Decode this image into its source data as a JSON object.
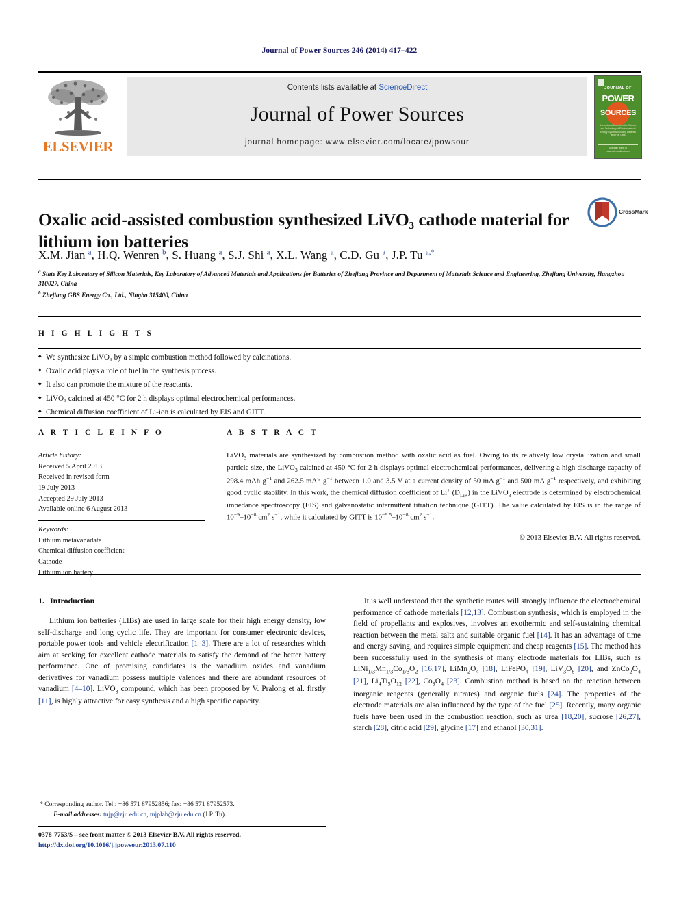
{
  "running_head": "Journal of Power Sources 246 (2014) 417–422",
  "masthead": {
    "publisher_name": "ELSEVIER",
    "contents_prefix": "Contents lists available at ",
    "sciencedirect": "ScienceDirect",
    "journal_title": "Journal of Power Sources",
    "homepage": "journal homepage: www.elsevier.com/locate/jpowsour",
    "cover": {
      "line1": "JOURNAL OF",
      "line2": "POWER",
      "line3": "SOURCES",
      "subtitle": "International Journal on the Science and Technology of Electrochemical Energy Systems including Batteries and Fuel Cells",
      "footer": "Available online at www.sciencedirect.com"
    }
  },
  "article": {
    "title": "Oxalic acid-assisted combustion synthesized LiVO₃ cathode material for lithium ion batteries",
    "crossmark_label": "CrossMark",
    "authors_html": "X.M. Jian <sup>a</sup>, H.Q. Wenren <sup>b</sup>, S. Huang <sup>a</sup>, S.J. Shi <sup>a</sup>, X.L. Wang <sup>a</sup>, C.D. Gu <sup>a</sup>, J.P. Tu <sup>a,*</sup>",
    "affiliation_a": "State Key Laboratory of Silicon Materials, Key Laboratory of Advanced Materials and Applications for Batteries of Zhejiang Province and Department of Materials Science and Engineering, Zhejiang University, Hangzhou 310027, China",
    "affiliation_b": "Zhejiang GBS Energy Co., Ltd., Ningbo 315400, China"
  },
  "highlights": {
    "heading": "H I G H L I G H T S",
    "items": [
      "We synthesize LiVO₃ by a simple combustion method followed by calcinations.",
      "Oxalic acid plays a role of fuel in the synthesis process.",
      "It also can promote the mixture of the reactants.",
      "LiVO₃ calcined at 450 °C for 2 h displays optimal electrochemical performances.",
      "Chemical diffusion coefficient of Li-ion is calculated by EIS and GITT."
    ]
  },
  "article_info": {
    "heading": "A R T I C L E   I N F O",
    "history_label": "Article history:",
    "history": [
      "Received 5 April 2013",
      "Received in revised form",
      "19 July 2013",
      "Accepted 29 July 2013",
      "Available online 6 August 2013"
    ],
    "keywords_label": "Keywords:",
    "keywords": [
      "Lithium metavanadate",
      "Chemical diffusion coefficient",
      "Cathode",
      "Lithium ion battery"
    ]
  },
  "abstract": {
    "heading": "A B S T R A C T",
    "text_html": "LiVO<sub>3</sub> materials are synthesized by combustion method with oxalic acid as fuel. Owing to its relatively low crystallization and small particle size, the LiVO<sub>3</sub> calcined at 450 °C for 2 h displays optimal electrochemical performances, delivering a high discharge capacity of 298.4 mAh g<sup>−1</sup> and 262.5 mAh g<sup>−1</sup> between 1.0 and 3.5 V at a current density of 50 mA g<sup>−1</sup> and 500 mA g<sup>−1</sup> respectively, and exhibiting good cyclic stability. In this work, the chemical diffusion coefficient of Li<sup>+</sup> (D<sub>Li+</sub>) in the LiVO<sub>3</sub> electrode is determined by electrochemical impedance spectroscopy (EIS) and galvanostatic intermittent titration technique (GITT). The value calculated by EIS is in the range of 10<sup>−9</sup>–10<sup>−8</sup> cm<sup>2</sup> s<sup>−1</sup>, while it calculated by GITT is 10<sup>−9.5</sup>–10<sup>−8</sup> cm<sup>2</sup> s<sup>−1</sup>.",
    "copyright": "© 2013 Elsevier B.V. All rights reserved."
  },
  "introduction": {
    "number": "1.",
    "heading": "Introduction",
    "left_paragraph_html": "Lithium ion batteries (LIBs) are used in large scale for their high energy density, low self-discharge and long cyclic life. They are important for consumer electronic devices, portable power tools and vehicle electrification <span class=\"cite\">[1–3]</span>. There are a lot of researches which aim at seeking for excellent cathode materials to satisfy the demand of the better battery performance. One of promising candidates is the vanadium oxides and vanadium derivatives for vanadium possess multiple valences and there are abundant resources of vanadium <span class=\"cite\">[4–10]</span>. LiVO<sub>3</sub> compound, which has been proposed by V. Pralong et al. firstly <span class=\"cite\">[11]</span>, is highly attractive for easy synthesis and a high specific capacity.",
    "right_paragraph_html": "It is well understood that the synthetic routes will strongly influence the electrochemical performance of cathode materials <span class=\"cite\">[12,13]</span>. Combustion synthesis, which is employed in the field of propellants and explosives, involves an exothermic and self-sustaining chemical reaction between the metal salts and suitable organic fuel <span class=\"cite\">[14]</span>. It has an advantage of time and energy saving, and requires simple equipment and cheap reagents <span class=\"cite\">[15]</span>. The method has been successfully used in the synthesis of many electrode materials for LIBs, such as LiNi<sub>1/3</sub>Mn<sub>1/3</sub>Co<sub>1/3</sub>O<sub>2</sub> <span class=\"cite\">[16,17]</span>, LiMn<sub>2</sub>O<sub>4</sub> <span class=\"cite\">[18]</span>, LiFePO<sub>4</sub> <span class=\"cite\">[19]</span>, LiV<sub>3</sub>O<sub>8</sub> <span class=\"cite\">[20]</span>, and ZnCo<sub>2</sub>O<sub>4</sub> <span class=\"cite\">[21]</span>, Li<sub>4</sub>Ti<sub>5</sub>O<sub>12</sub> <span class=\"cite\">[22]</span>, Co<sub>3</sub>O<sub>4</sub> <span class=\"cite\">[23]</span>. Combustion method is based on the reaction between inorganic reagents (generally nitrates) and organic fuels <span class=\"cite\">[24]</span>. The properties of the electrode materials are also influenced by the type of the fuel <span class=\"cite\">[25]</span>. Recently, many organic fuels have been used in the combustion reaction, such as urea <span class=\"cite\">[18,20]</span>, sucrose <span class=\"cite\">[26,27]</span>, starch <span class=\"cite\">[28]</span>, citric acid <span class=\"cite\">[29]</span>, glycine <span class=\"cite\">[17]</span> and ethanol <span class=\"cite\">[30,31]</span>."
  },
  "footnote": {
    "marker": "*",
    "corresponding_html": "Corresponding author. Tel.: +86 571 87952856; fax: +86 571 87952573.",
    "email_label": "E-mail addresses:",
    "email1": "tujp@zju.edu.cn",
    "email2": "tujplab@zju.edu.cn",
    "email_suffix": "(J.P. Tu)."
  },
  "footer": {
    "issn_line": "0378-7753/$ – see front matter © 2013 Elsevier B.V. All rights reserved.",
    "doi": "http://dx.doi.org/10.1016/j.jpowsour.2013.07.110"
  },
  "colors": {
    "elsevier_orange": "#E87722",
    "link_blue": "#1c3f94",
    "running_head_navy": "#1a1a5e",
    "cover_green": "#4e8f2d",
    "cover_orange": "#e2571e"
  }
}
